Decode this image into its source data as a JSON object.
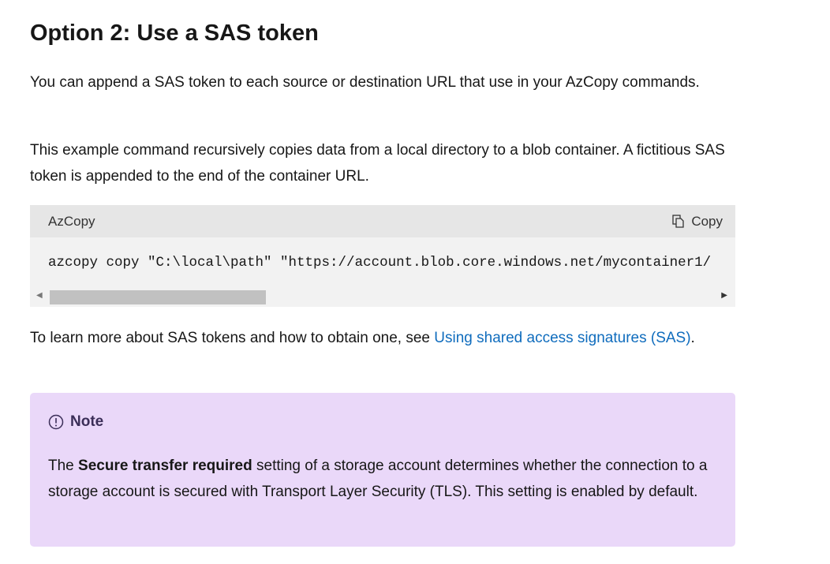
{
  "heading": "Option 2: Use a SAS token",
  "para1": "You can append a SAS token to each source or destination URL that use in your AzCopy commands.",
  "para2": "This example command recursively copies data from a local directory to a blob container. A fictitious SAS token is appended to the end of the container URL.",
  "code_block": {
    "language": "AzCopy",
    "copy_label": "Copy",
    "code": "azcopy copy \"C:\\local\\path\" \"https://account.blob.core.windows.net/mycontainer1/"
  },
  "para3": {
    "text": "To learn more about SAS tokens and how to obtain one, see ",
    "link": "Using shared access signatures (SAS)",
    "end": "."
  },
  "note": {
    "title": "Note",
    "bold": "Secure transfer required",
    "pre": "The ",
    "post": " setting of a storage account determines whether the connection to a storage account is secured with Transport Layer Security (TLS). This setting is enabled by default."
  }
}
